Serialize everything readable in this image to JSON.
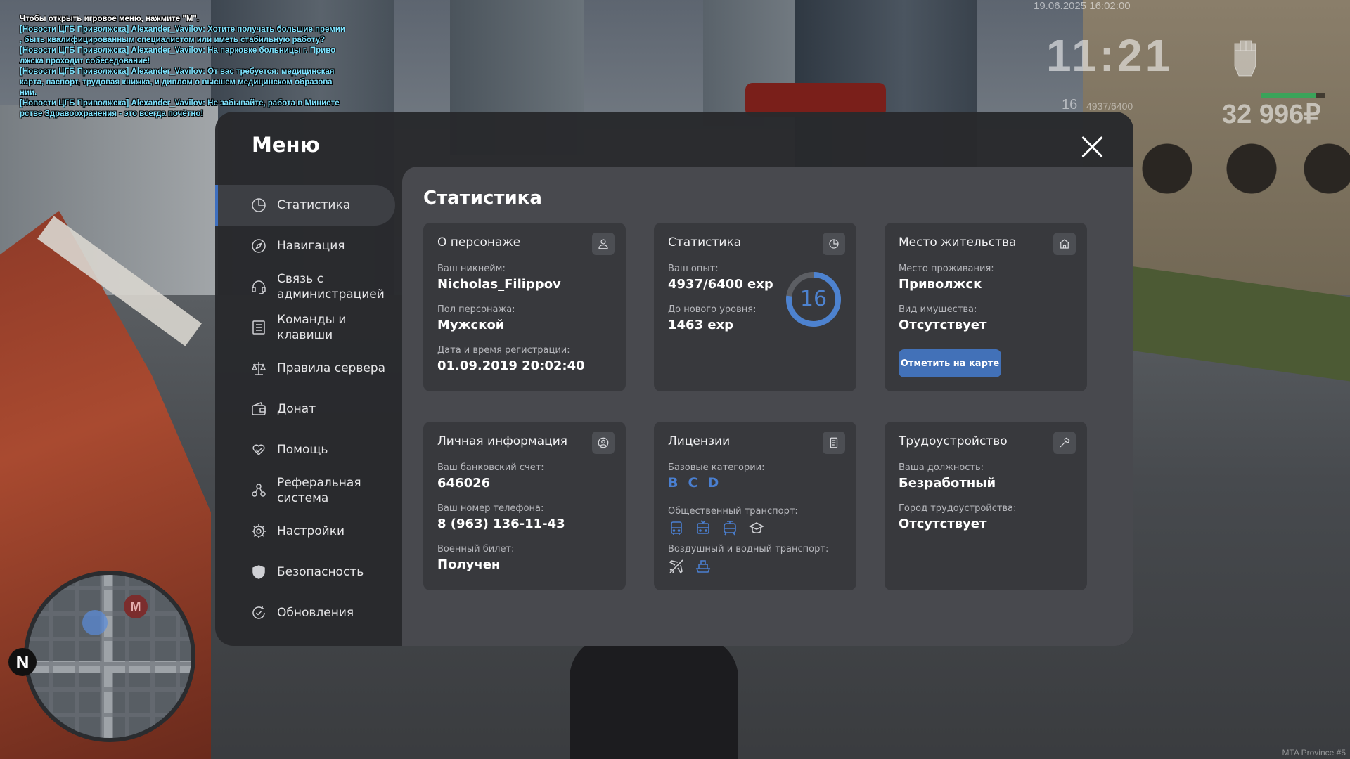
{
  "hud": {
    "chat": [
      {
        "kind": "hint",
        "text": "Чтобы открыть игровое меню, нажмите \"M\"."
      },
      {
        "kind": "news",
        "text": "[Новости ЦГБ Приволжска] Alexander_Vavilov: Хотите получать большие премии"
      },
      {
        "kind": "news",
        "text": ", быть квалифицированным специалистом или иметь стабильную работу?"
      },
      {
        "kind": "news",
        "text": "[Новости ЦГБ Приволжска] Alexander_Vavilov: На парковке больницы г. Приво"
      },
      {
        "kind": "news",
        "text": "лжска проходит собеседование!"
      },
      {
        "kind": "news",
        "text": "[Новости ЦГБ Приволжска] Alexander_Vavilov: От вас требуется: медицинская"
      },
      {
        "kind": "news",
        "text": "карта, паспорт, трудовая книжка, и диплом о высшем медицинском образова"
      },
      {
        "kind": "news",
        "text": "нии."
      },
      {
        "kind": "news",
        "text": "[Новости ЦГБ Приволжска] Alexander_Vavilov: Не забывайте, работа в Министе"
      },
      {
        "kind": "news",
        "text": "рстве Здравоохранения - это всегда почётно!"
      }
    ],
    "datetime": "19.06.2025 16:02:00",
    "clock": "11:21",
    "level": "16",
    "exp": "4937/6400",
    "money": "32 996₽",
    "health_fraction": 0.85,
    "watermark": "MTA Province #5",
    "minimap_north": "N",
    "minimap_marker": "M"
  },
  "menu": {
    "title": "Меню",
    "sidebar": [
      {
        "label": "Статистика",
        "icon": "chart-pie-icon",
        "active": true
      },
      {
        "label": "Навигация",
        "icon": "compass-icon"
      },
      {
        "label": "Связь с администрацией",
        "icon": "headset-icon"
      },
      {
        "label": "Команды и клавиши",
        "icon": "list-icon"
      },
      {
        "label": "Правила сервера",
        "icon": "scales-icon"
      },
      {
        "label": "Донат",
        "icon": "wallet-icon"
      },
      {
        "label": "Помощь",
        "icon": "heart-hands-icon"
      },
      {
        "label": "Реферальная система",
        "icon": "referral-icon"
      },
      {
        "label": "Настройки",
        "icon": "gear-icon"
      },
      {
        "label": "Безопасность",
        "icon": "shield-icon"
      },
      {
        "label": "Обновления",
        "icon": "refresh-check-icon"
      }
    ],
    "content_title": "Статистика",
    "cards": {
      "character": {
        "title": "О персонаже",
        "nickname_label": "Ваш никнейм:",
        "nickname": "Nicholas_Filippov",
        "gender_label": "Пол персонажа:",
        "gender": "Мужской",
        "reg_label": "Дата и время регистрации:",
        "reg": "01.09.2019 20:02:40"
      },
      "stats": {
        "title": "Статистика",
        "exp_label": "Ваш опыт:",
        "exp": "4937/6400 exp",
        "next_label": "До нового уровня:",
        "next": "1463 exp",
        "level": "16",
        "progress": 0.771,
        "ring_color": "#4d82cf"
      },
      "residence": {
        "title": "Место жительства",
        "place_label": "Место проживания:",
        "place": "Приволжск",
        "property_label": "Вид имущества:",
        "property": "Отсутствует",
        "button": "Отметить на карте"
      },
      "personal": {
        "title": "Личная информация",
        "bank_label": "Ваш банковский счет:",
        "bank": "646026",
        "phone_label": "Ваш номер телефона:",
        "phone": "8 (963) 136-11-43",
        "military_label": "Военный билет:",
        "military": "Получен"
      },
      "licenses": {
        "title": "Лицензии",
        "base_label": "Базовые категории:",
        "categories": [
          "B",
          "C",
          "D"
        ],
        "public_label": "Общественный транспорт:",
        "public_icons": [
          "bus-icon",
          "trolleybus-icon",
          "tram-icon",
          "driver-cap-icon"
        ],
        "air_label": "Воздушный и водный транспорт:",
        "air_icons": [
          "airplane-icon",
          "boat-icon"
        ],
        "active_color": "#4a7fd0",
        "inactive_color": "#cfd0d4"
      },
      "job": {
        "title": "Трудоустройство",
        "position_label": "Ваша должность:",
        "position": "Безработный",
        "city_label": "Город трудоустройства:",
        "city": "Отсутствует"
      }
    }
  }
}
